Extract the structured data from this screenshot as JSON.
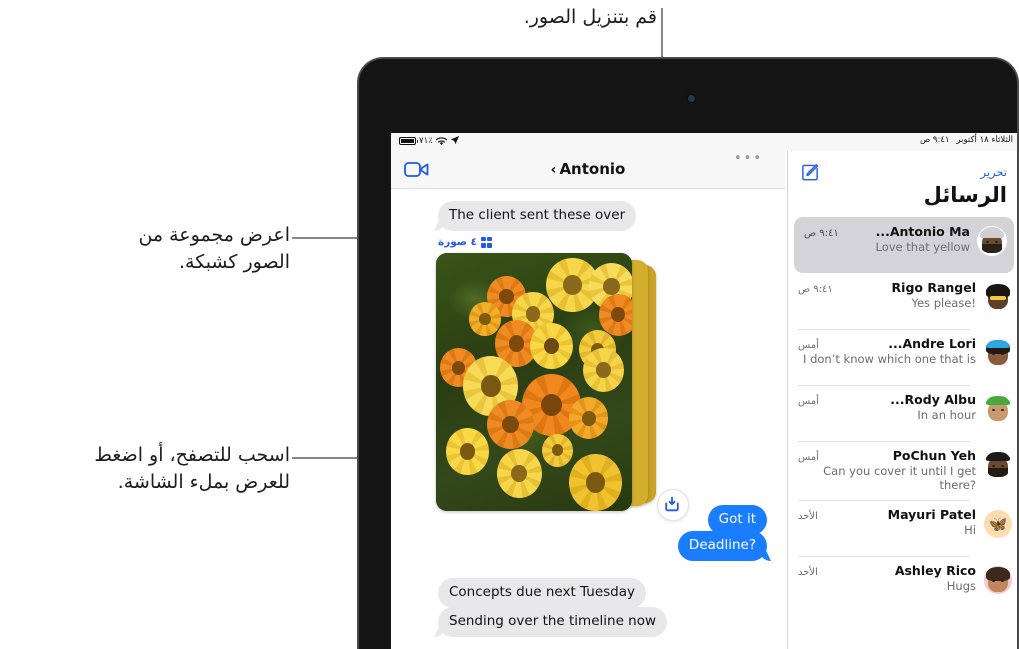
{
  "callouts": [
    {
      "id": "download-photos",
      "text": "قم بتنزيل الصور."
    },
    {
      "id": "view-grid",
      "text": "اعرض مجموعة من\nالصور كشبكة."
    },
    {
      "id": "swipe-browse",
      "text": "اسحب للتصفح، أو اضغط\nللعرض بملء الشاشة."
    }
  ],
  "statusbar": {
    "battery_percent": "٧١٪",
    "wifi_icon": "wifi-icon",
    "location_icon": "location-arrow-icon",
    "date": "الثلاثاء ١٨ أكتوبر",
    "time": "٩:٤١ ص"
  },
  "conversation": {
    "video_call_icon": "video-camera-icon",
    "back_chevron": "‹",
    "title": "Antonio",
    "overflow_icon": "more-dots-icon",
    "grid_label": "٤ صورة",
    "grid_icon": "grid-2x2-icon",
    "download_icon": "download-icon",
    "bubbles": [
      {
        "text": "The client sent these over",
        "side": "them"
      },
      {
        "text": "Got it",
        "side": "me"
      },
      {
        "text": "Deadline?",
        "side": "me"
      },
      {
        "text": "Concepts due next Tuesday",
        "side": "them"
      },
      {
        "text": "Sending over the timeline now",
        "side": "them"
      }
    ]
  },
  "messages_list": {
    "compose_icon": "compose-icon",
    "edit_label": "تحرير",
    "title": "الرسائل",
    "rows": [
      {
        "name": "Antonio Ma...",
        "time": "٩:٤١ ص",
        "preview": "Love that yellow",
        "selected": true
      },
      {
        "name": "Rigo Rangel",
        "time": "٩:٤١ ص",
        "preview": "Yes please!",
        "selected": false
      },
      {
        "name": "Andre Lori...",
        "time": "أمس",
        "preview": "I don’t know which one that is",
        "selected": false
      },
      {
        "name": "Rody Albu...",
        "time": "أمس",
        "preview": "In an hour",
        "selected": false
      },
      {
        "name": "PoChun Yeh",
        "time": "أمس",
        "preview": "Can you cover it until I get there?",
        "selected": false
      },
      {
        "name": "Mayuri Patel",
        "time": "الأحد",
        "preview": "Hi",
        "selected": false
      },
      {
        "name": "Ashley Rico",
        "time": "الأحد",
        "preview": "Hugs",
        "selected": false
      }
    ]
  },
  "colors": {
    "accent_blue": "#2359e8",
    "bubble_blue": "#1a7cff",
    "bubble_gray": "#e8e8ea",
    "selected_row": "#d4d4d8",
    "text_primary": "#111111",
    "text_secondary": "#6c6c70"
  }
}
